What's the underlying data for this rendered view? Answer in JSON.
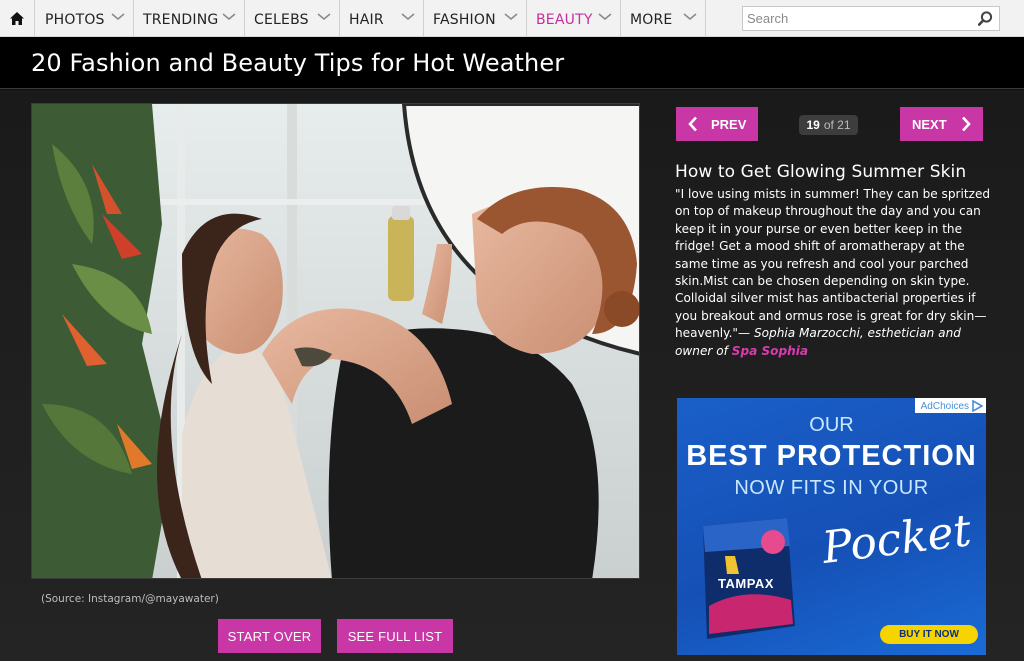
{
  "nav": {
    "items": [
      {
        "label": "PHOTOS"
      },
      {
        "label": "TRENDING"
      },
      {
        "label": "CELEBS"
      },
      {
        "label": "HAIR"
      },
      {
        "label": "FASHION"
      },
      {
        "label": "BEAUTY",
        "active": true
      },
      {
        "label": "MORE"
      }
    ],
    "search_placeholder": "Search",
    "active_color": "#c62f9b",
    "icons": {
      "home": "home-icon",
      "chevron": "chevron-down-icon",
      "search": "search-icon"
    }
  },
  "page": {
    "title": "20 Fashion and Beauty Tips for Hot Weather"
  },
  "slide": {
    "source_caption": "(Source: Instagram/@mayawater)",
    "start_over": "START OVER",
    "see_full_list": "SEE FULL LIST",
    "prev_label": "PREV",
    "next_label": "NEXT",
    "current": "19",
    "of_total": "of 21",
    "heading": "How to Get Glowing Summer Skin",
    "quote": "\"I love using mists in summer! They can be spritzed on top of makeup throughout the day and you can keep it in your purse or even better keep in the fridge! Get a mood shift of aromatherapy at the same time as you refresh and cool your parched skin.Mist can be chosen depending on skin type. Colloidal silver mist has antibacterial properties if you breakout and ormus rose is great for dry skin—heavenly.\"—",
    "attribution": "Sophia Marzocchi, esthetician and owner of",
    "attribution_link": "Spa Sophia",
    "accent_color": "#c936a5"
  },
  "ad": {
    "adchoices": "AdChoices",
    "line1": "OUR",
    "line2": "BEST PROTECTION",
    "line3": "NOW FITS IN YOUR",
    "line4": "Pocket",
    "product": "TAMPAX",
    "buy_now": "BUY IT NOW"
  }
}
